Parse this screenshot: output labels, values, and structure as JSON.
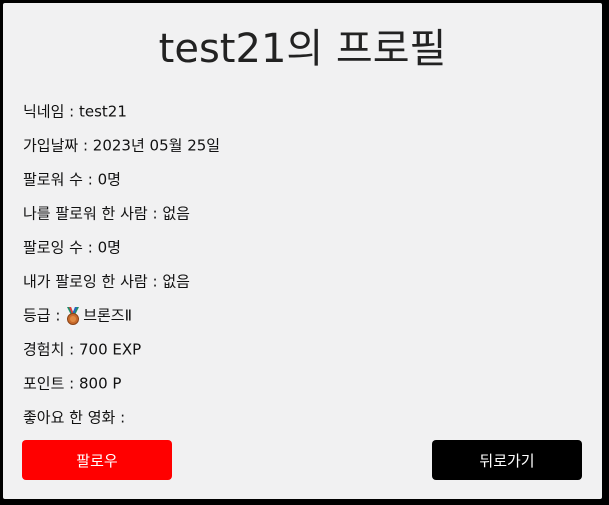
{
  "profile": {
    "title": "test21의 프로필",
    "fields": [
      {
        "label": "닉네임",
        "value": "test21"
      },
      {
        "label": "가입날짜",
        "value": "2023년 05월 25일"
      },
      {
        "label": "팔로워 수",
        "value": "0명"
      },
      {
        "label": "나를 팔로워 한 사람",
        "value": "없음"
      },
      {
        "label": "팔로잉 수",
        "value": "0명"
      },
      {
        "label": "내가 팔로잉 한 사람",
        "value": "없음"
      },
      {
        "label": "등급",
        "value": "브론즈Ⅱ",
        "icon": "bronze-medal-icon"
      },
      {
        "label": "경험치",
        "value": "700 EXP"
      },
      {
        "label": "포인트",
        "value": "800 P"
      },
      {
        "label": "좋아요 한 영화",
        "value": ""
      }
    ],
    "separator": " : "
  },
  "actions": {
    "follow_label": "팔로우",
    "back_label": "뒤로가기"
  },
  "colors": {
    "follow_button": "#ff0000",
    "back_button": "#000000",
    "card_background": "#f1f1f2"
  }
}
